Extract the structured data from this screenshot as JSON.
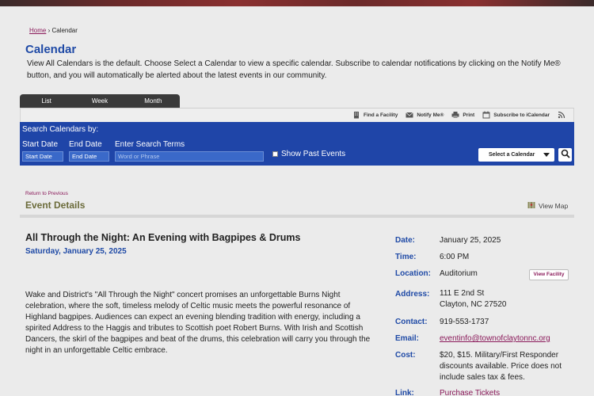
{
  "breadcrumb": {
    "home": "Home",
    "separator": " › ",
    "current": "Calendar"
  },
  "page": {
    "title": "Calendar",
    "intro": "View All Calendars is the default. Choose Select a Calendar to view a specific calendar. Subscribe to calendar notifications by clicking on the Notify Me® button, and you will automatically be alerted about the latest events in our community."
  },
  "tabs": [
    "List",
    "Week",
    "Month"
  ],
  "toolbar": {
    "find_facility": "Find a Facility",
    "notify_me": "Notify Me®",
    "print": "Print",
    "subscribe": "Subscribe to iCalendar"
  },
  "search": {
    "title": "Search Calendars by:",
    "start_label": "Start Date",
    "end_label": "End Date",
    "terms_label": "Enter Search Terms",
    "start_value": "Start Date",
    "end_value": "End Date",
    "terms_placeholder": "Word or Phrase",
    "past_events": "Show Past Events",
    "select_calendar": "Select a Calendar"
  },
  "event_details": {
    "return_link": "Return to Previous",
    "heading": "Event Details",
    "view_map": "View Map"
  },
  "event": {
    "title": "All Through the Night: An Evening with Bagpipes & Drums",
    "date": "Saturday, January 25, 2025",
    "description": "Wake and District's \"All Through the Night\" concert promises an unforgettable Burns Night celebration, where the soft, timeless melody of Celtic music meets the powerful resonance of Highland bagpipes. Audiences can expect an evening blending tradition with energy, including a spirited Address to the Haggis and tributes to Scottish poet Robert Burns. With Irish and Scottish Dancers, the skirl of the bagpipes and beat of the drums, this celebration will carry you through the night in an unforgettable Celtic embrace."
  },
  "details": {
    "date_label": "Date:",
    "date": "January 25, 2025",
    "time_label": "Time:",
    "time": "6:00 PM",
    "location_label": "Location:",
    "location": "Auditorium",
    "view_facility": "View Facility",
    "address_label": "Address:",
    "address_line1": "111 E 2nd St",
    "address_line2": "Clayton, NC 27520",
    "contact_label": "Contact:",
    "contact": "919-553-1737",
    "email_label": "Email:",
    "email": "eventinfo@townofclaytonnc.org",
    "cost_label": "Cost:",
    "cost": "$20, $15. Military/First Responder discounts available. Price does not include sales tax & fees.",
    "link_label": "Link:",
    "link": "Purchase Tickets"
  },
  "colors": {
    "accent": "#1f4aa6",
    "search_bar": "#1f45a8",
    "link": "#8a1a5a",
    "tab_bar": "#3a3a3a"
  }
}
